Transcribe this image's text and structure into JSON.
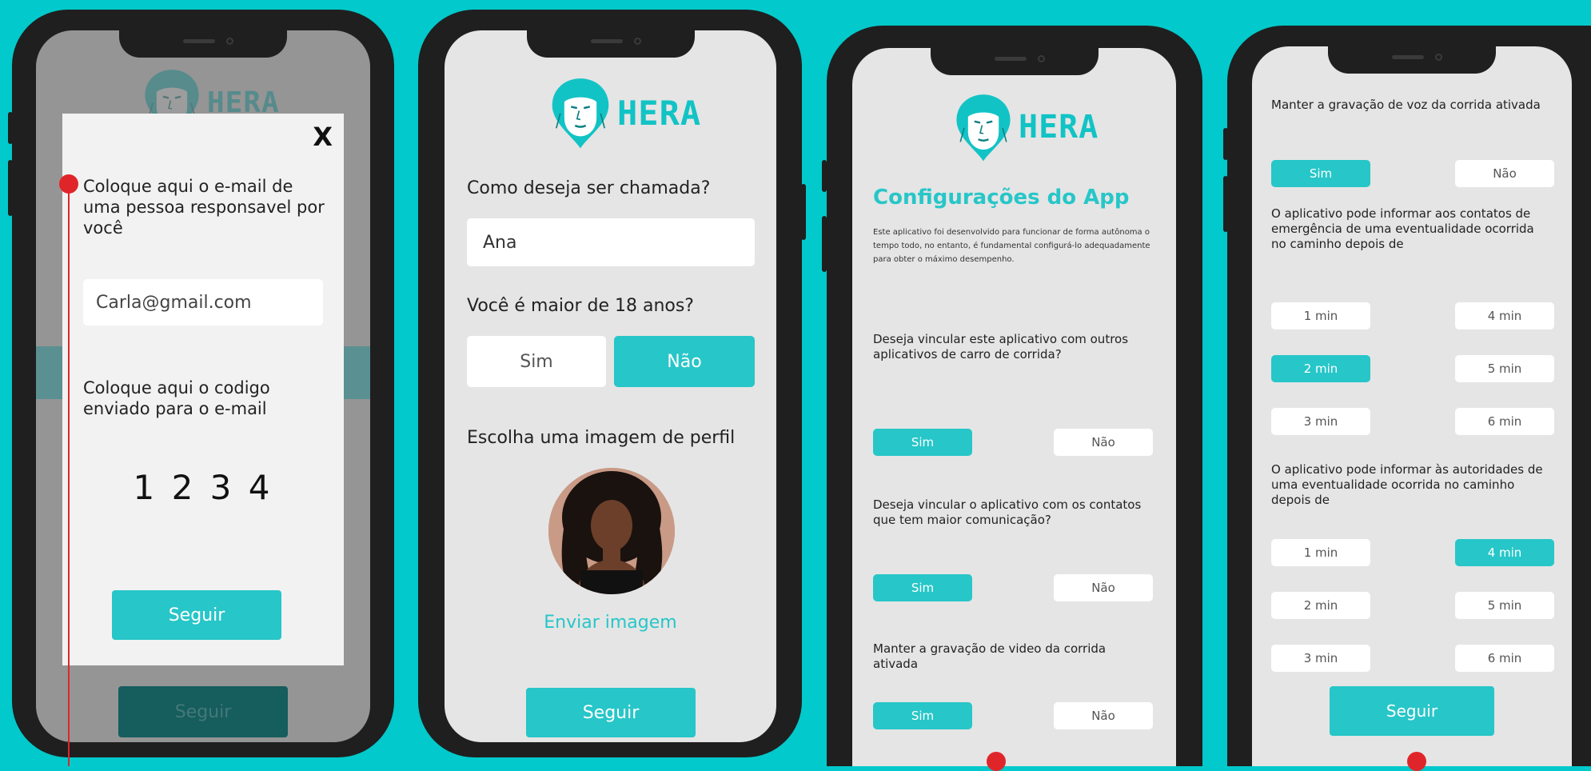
{
  "brand": {
    "name": "HERA",
    "icon": "woman-face-pin-icon",
    "accent_color": "#27c6c8",
    "background_color": "#02c9cb"
  },
  "screen1": {
    "modal": {
      "close_label": "X",
      "email_prompt": "Coloque aqui o e-mail de uma pessoa responsavel por você",
      "email_value": "Carla@gmail.com",
      "code_prompt": "Coloque aqui o codigo enviado para o e-mail",
      "code_value": "1 2 3 4",
      "submit_label": "Seguir"
    },
    "background_button_label": "Seguir"
  },
  "screen2": {
    "name_question": "Como deseja ser chamada?",
    "name_value": "Ana",
    "age_question": "Você é maior de 18 anos?",
    "yes_label": "Sim",
    "no_label": "Não",
    "selected": "Não",
    "image_prompt": "Escolha uma imagem de perfil",
    "upload_link": "Enviar imagem",
    "submit_label": "Seguir"
  },
  "screen3": {
    "title": "Configurações do App",
    "description": "Este aplicativo foi desenvolvido para funcionar de forma autônoma o tempo todo, no entanto, é fundamental configurá-lo adequadamente para obter o máximo desempenho.",
    "q1": "Deseja vincular este aplicativo com outros aplicativos de carro de corrida?",
    "q2": "Deseja vincular o aplicativo com os contatos que tem maior comunicação?",
    "q3": "Manter a gravação de video da corrida ativada",
    "yes_label": "Sim",
    "no_label": "Não"
  },
  "screen4": {
    "q1": "Manter a gravação de voz da corrida ativada",
    "q2": "O aplicativo pode informar aos contatos de emergência de uma eventualidade ocorrida no caminho depois de",
    "q3": "O aplicativo pode informar às autoridades de uma eventualidade ocorrida no caminho depois de",
    "yes_label": "Sim",
    "no_label": "Não",
    "times": [
      "1 min",
      "2 min",
      "3 min",
      "4 min",
      "5 min",
      "6 min"
    ],
    "q2_selected": "2 min",
    "q3_selected": "4 min",
    "submit_label": "Seguir"
  }
}
